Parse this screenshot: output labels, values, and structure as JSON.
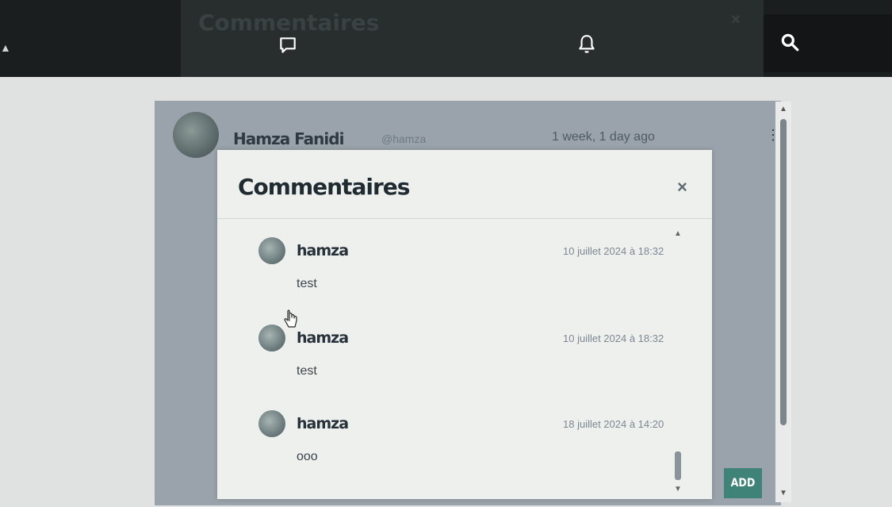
{
  "topbar": {
    "ghost_title": "Commentaires",
    "ghost_close": "×",
    "icons": [
      "chat-icon",
      "bell-icon",
      "search-icon"
    ]
  },
  "post": {
    "author": "Hamza Fanidi",
    "handle": "@hamza",
    "time": "1 week, 1 day ago",
    "menu": "⋮"
  },
  "modal": {
    "title": "Commentaires",
    "close": "×"
  },
  "comments": [
    {
      "author": "hamza",
      "date": "10 juillet 2024 à 18:32",
      "text": "test"
    },
    {
      "author": "hamza",
      "date": "10 juillet 2024 à 18:32",
      "text": "test"
    },
    {
      "author": "hamza",
      "date": "18 juillet 2024 à 14:20",
      "text": "ooo"
    }
  ],
  "add_button": "ADD",
  "colors": {
    "topbar": "#1b1e1f",
    "add_button": "#3f8278",
    "modal_bg": "#eef0ee"
  }
}
